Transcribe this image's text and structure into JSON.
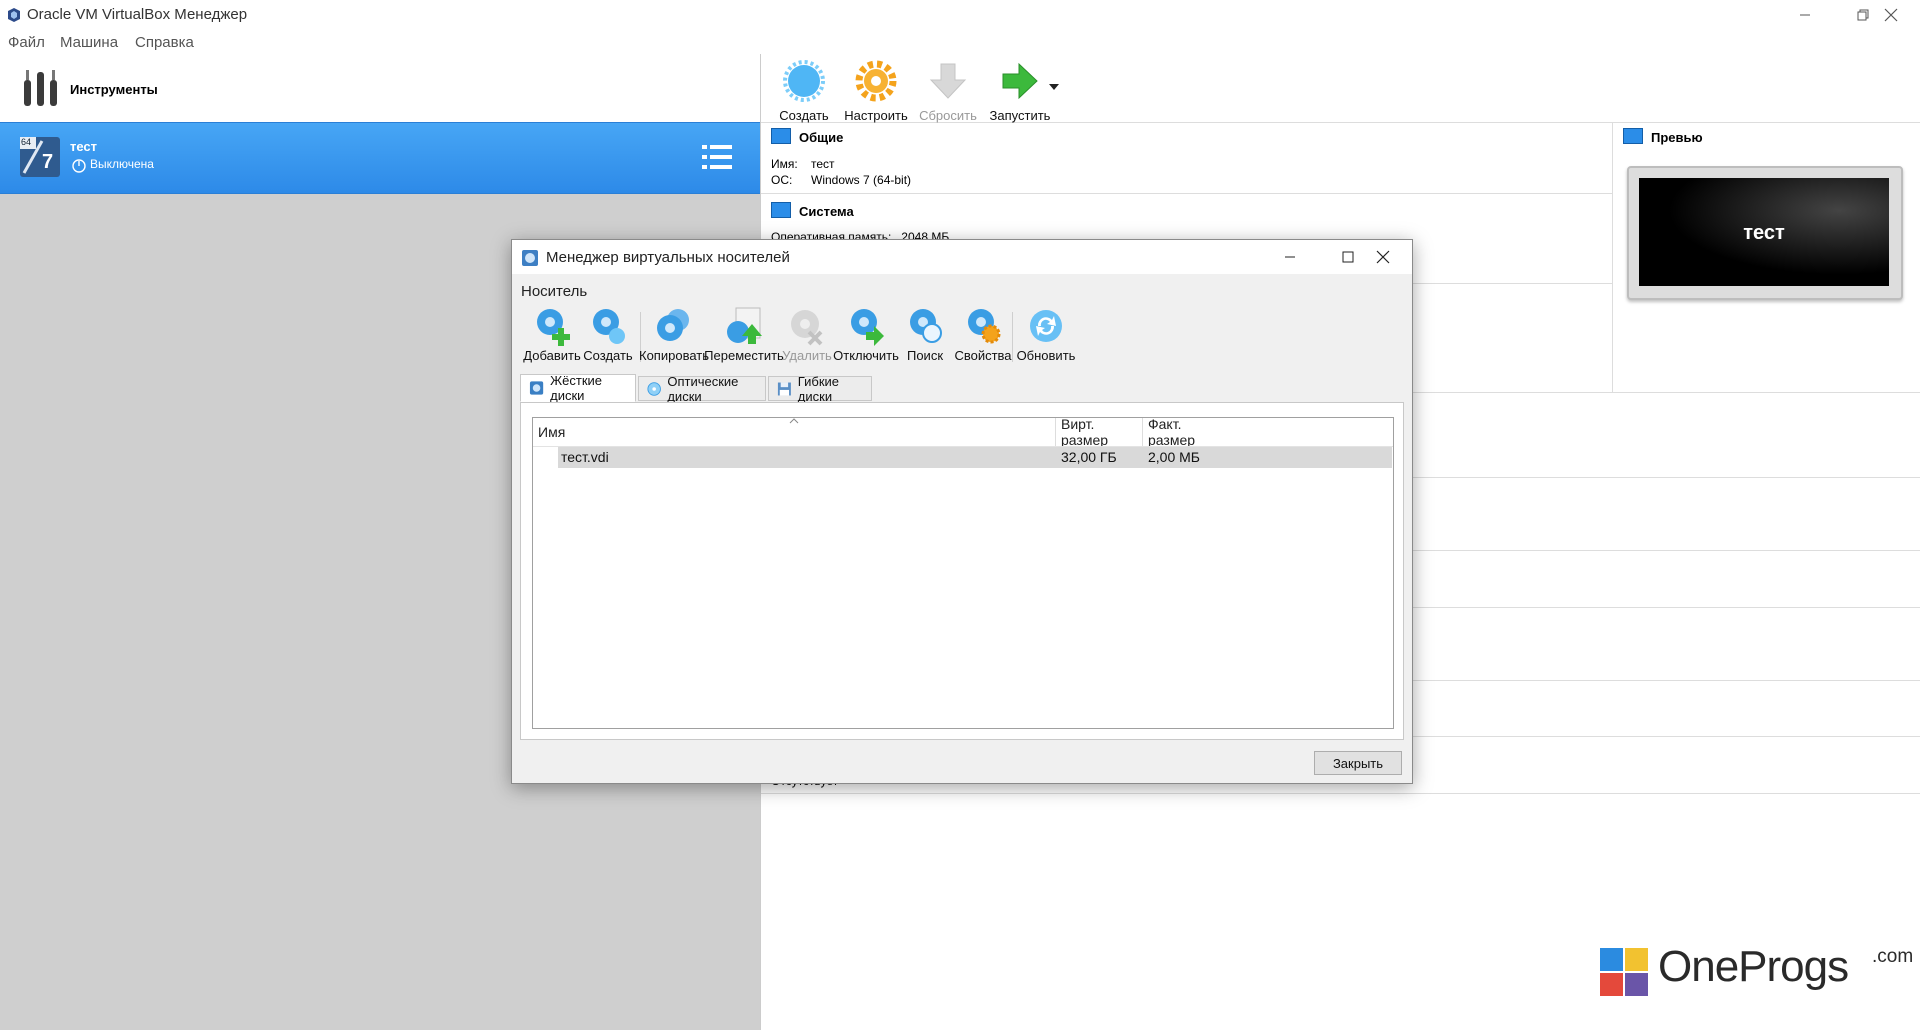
{
  "window": {
    "title": "Oracle VM VirtualBox Менеджер"
  },
  "menu": [
    "Файл",
    "Машина",
    "Справка"
  ],
  "left": {
    "tools_label": "Инструменты",
    "vm": {
      "name": "тест",
      "state": "Выключена",
      "badge": "64",
      "os_badge": "7"
    }
  },
  "toolbar": {
    "create": "Создать",
    "settings": "Настроить",
    "discard": "Сбросить",
    "start": "Запустить"
  },
  "details": {
    "general_title": "Общие",
    "name_key": "Имя:",
    "name_val": "тест",
    "os_key": "ОС:",
    "os_val": "Windows 7 (64-bit)",
    "system_title": "Система",
    "ram_text": "Оперативная память:   2048 МБ",
    "absent_text": "Отсутствует"
  },
  "preview": {
    "title": "Превью",
    "screen_text": "тест"
  },
  "dialog": {
    "title": "Менеджер виртуальных носителей",
    "menu": "Носитель",
    "tools": {
      "add": "Добавить",
      "create": "Создать",
      "copy": "Копировать",
      "move": "Переместить",
      "remove": "Удалить",
      "release": "Отключить",
      "search": "Поиск",
      "properties": "Свойства",
      "refresh": "Обновить"
    },
    "tabs": [
      "Жёсткие диски",
      "Оптические диски",
      "Гибкие диски"
    ],
    "columns": [
      "Имя",
      "Вирт. размер",
      "Факт. размер"
    ],
    "rows": [
      {
        "name": "тест.vdi",
        "virt": "32,00 ГБ",
        "actual": "2,00 МБ"
      }
    ],
    "close": "Закрыть"
  },
  "watermark": {
    "text": "OneProgs",
    "domain": ".com"
  },
  "colors": {
    "selection": "#3a98ef",
    "accent_green": "#3cb93c",
    "accent_orange": "#f4a31c"
  }
}
